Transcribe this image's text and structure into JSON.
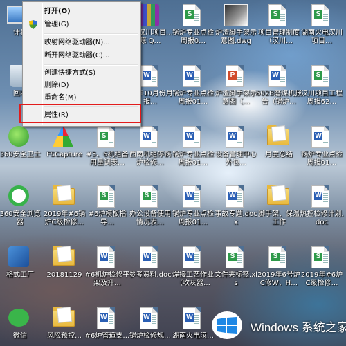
{
  "context_menu": {
    "items": [
      {
        "label": "打开(O)",
        "bold": true
      },
      {
        "label": "管理(G)",
        "shield": true
      },
      {
        "label": "映射网络驱动器(N)..."
      },
      {
        "label": "断开网络驱动器(C)..."
      },
      {
        "label": "创建快捷方式(S)"
      },
      {
        "label": "删除(D)"
      },
      {
        "label": "重命名(M)"
      },
      {
        "label": "属性(R)",
        "highlighted": true
      }
    ]
  },
  "desktop_icons": [
    {
      "label": "计算",
      "type": "computer"
    },
    {
      "label": "回收",
      "type": "bin"
    },
    {
      "label": "18 汉川项目…陈 Q…",
      "type": "rar"
    },
    {
      "label": "锅炉专业点检周报0…",
      "type": "doc-s"
    },
    {
      "label": "炉渣脚手架示意图.dwg",
      "type": "img"
    },
    {
      "label": "项目管理制度（汉川…",
      "type": "doc-s"
    },
    {
      "label": "湖南火电汉川项目…",
      "type": "doc-s"
    },
    {
      "label": "18年10月份月报…",
      "type": "doc-w"
    },
    {
      "label": "锅炉专业点检周报01…",
      "type": "doc-w"
    },
    {
      "label": "炉渣脚手架示意图（…",
      "type": "doc-p"
    },
    {
      "label": "602B磨煤机报告（锅炉…",
      "type": "doc-w"
    },
    {
      "label": "汉川项目工程周报62…",
      "type": "doc-s"
    },
    {
      "label": "360安全卫士",
      "type": "app360"
    },
    {
      "label": "FSCapture",
      "type": "fscap"
    },
    {
      "label": "#5、6机组备用量调表…",
      "type": "doc-s"
    },
    {
      "label": "西南机组停锅炉检修…",
      "type": "doc-w"
    },
    {
      "label": "锅炉专业点检周报01…",
      "type": "doc-w"
    },
    {
      "label": "设备管理中心外包…",
      "type": "doc-w"
    },
    {
      "label": "月度总结",
      "type": "folder"
    },
    {
      "label": "锅炉专业点检周报01…",
      "type": "doc-w"
    },
    {
      "label": "360安全浏览器",
      "type": "appie"
    },
    {
      "label": "2019年#6锅炉C级检修…",
      "type": "folder"
    },
    {
      "label": "#6炉模板指导…",
      "type": "doc-s"
    },
    {
      "label": "办公设备使用情况表…",
      "type": "doc-s"
    },
    {
      "label": "锅炉专业点检周报01…",
      "type": "doc-w"
    },
    {
      "label": "事故专题.docx",
      "type": "doc-w"
    },
    {
      "label": "脚手架、保温工作",
      "type": "folder"
    },
    {
      "label": "热控检修计划.doc",
      "type": "doc-w"
    },
    {
      "label": "格式工厂",
      "type": "gsgc"
    },
    {
      "label": "20181129",
      "type": "folder"
    },
    {
      "label": "#6机炉检修平架及升…",
      "type": "doc-w"
    },
    {
      "label": "参考资料.doc",
      "type": "doc-w"
    },
    {
      "label": "焊接工艺作业（吹灰器…",
      "type": "doc-w"
    },
    {
      "label": "文件夹标签.xls",
      "type": "doc-s"
    },
    {
      "label": "2019年6号炉C修W、H…",
      "type": "doc-s"
    },
    {
      "label": "2019年#6炉C级检修…",
      "type": "doc-s"
    },
    {
      "label": "微信",
      "type": "wechat"
    },
    {
      "label": "风险预控…",
      "type": "folder"
    },
    {
      "label": "#6炉管道支…",
      "type": "doc-w"
    },
    {
      "label": "锅炉检修规…",
      "type": "doc-w"
    },
    {
      "label": "湖南火电汉…",
      "type": "doc-w"
    }
  ],
  "watermark": {
    "brand": "Windows",
    "site": "系统之家"
  }
}
